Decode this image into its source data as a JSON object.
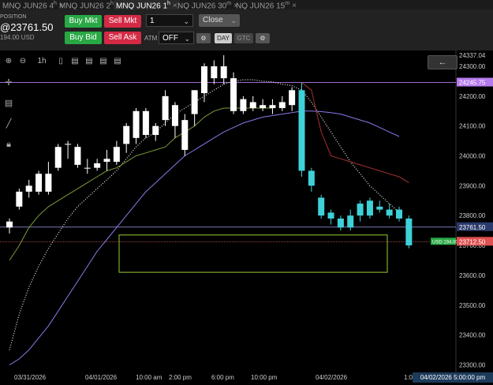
{
  "tabs": [
    {
      "label": "MNQ JUN26 4",
      "sup": "h",
      "active": false
    },
    {
      "label": "MNQ JUN26 2",
      "sup": "h",
      "active": false
    },
    {
      "label": "MNQ JUN26 1",
      "sup": "h",
      "active": true
    },
    {
      "label": "NQ JUN26 30",
      "sup": "m",
      "active": false
    },
    {
      "label": "NQ JUN26 15",
      "sup": "m",
      "active": false
    }
  ],
  "position": {
    "label": "POSITION",
    "price": "@23761.50",
    "sub": "194.00 USD"
  },
  "order": {
    "buy_mkt": "Buy Mkt",
    "sell_mkt": "Sell Mkt",
    "buy_bid": "Buy Bid",
    "sell_ask": "Sell Ask",
    "qty": "1",
    "close": "Close",
    "atm_label": "ATM",
    "atm_value": "OFF",
    "day": "DAY",
    "gtc": "GTC"
  },
  "toolbar": {
    "interval": "1h"
  },
  "price_axis": {
    "ticks": [
      "24337.04",
      "24300.00",
      "24200.00",
      "24100.00",
      "24000.00",
      "23900.00",
      "23800.00",
      "23700.00",
      "23600.00",
      "23500.00",
      "23400.00",
      "23300.00"
    ],
    "tick_values": [
      24337.04,
      24300,
      24200,
      24100,
      24000,
      23900,
      23800,
      23700,
      23600,
      23500,
      23400,
      23300
    ],
    "hline_upper_label": "24245.75",
    "hline_upper_value": 24245.75,
    "position_line_label": "23761.50",
    "position_line_value": 23761.5,
    "position_pnl": "USD 194.00",
    "last_price_label": "23712.50",
    "last_price_value": 23712.5,
    "colors": {
      "upper": "#b57bee",
      "position": "#2a3a6a",
      "pnl": "#29a845",
      "last": "#e05050"
    }
  },
  "time_axis": {
    "labels": [
      "03/31/2026",
      "04/01/2026",
      "10:00 am",
      "2:00 pm",
      "6:00 pm",
      "10:00 pm",
      "04/02/2026",
      "1:0"
    ],
    "crosshair_date": "04/02/2026 5:00:00 pm"
  },
  "chart_data": {
    "type": "candlestick",
    "ylim": [
      23280,
      24345
    ],
    "candles": [
      {
        "o": 23760,
        "h": 23790,
        "l": 23740,
        "c": 23780
      },
      {
        "o": 23830,
        "h": 23890,
        "l": 23820,
        "c": 23880
      },
      {
        "o": 23880,
        "h": 23920,
        "l": 23860,
        "c": 23900
      },
      {
        "o": 23880,
        "h": 23950,
        "l": 23870,
        "c": 23940
      },
      {
        "o": 23940,
        "h": 23980,
        "l": 23870,
        "c": 23880
      },
      {
        "o": 23960,
        "h": 24040,
        "l": 23950,
        "c": 24030
      },
      {
        "o": 24040,
        "h": 24050,
        "l": 23990,
        "c": 24040
      },
      {
        "o": 24030,
        "h": 24040,
        "l": 23960,
        "c": 23970
      },
      {
        "o": 23960,
        "h": 23990,
        "l": 23940,
        "c": 23960
      },
      {
        "o": 23960,
        "h": 23990,
        "l": 23950,
        "c": 23975
      },
      {
        "o": 23980,
        "h": 24020,
        "l": 23950,
        "c": 23990
      },
      {
        "o": 23980,
        "h": 24050,
        "l": 23970,
        "c": 24030
      },
      {
        "o": 24040,
        "h": 24110,
        "l": 24010,
        "c": 24100
      },
      {
        "o": 24060,
        "h": 24160,
        "l": 24040,
        "c": 24150
      },
      {
        "o": 24150,
        "h": 24160,
        "l": 24060,
        "c": 24070
      },
      {
        "o": 24070,
        "h": 24110,
        "l": 24050,
        "c": 24100
      },
      {
        "o": 24120,
        "h": 24220,
        "l": 24100,
        "c": 24200
      },
      {
        "o": 24100,
        "h": 24180,
        "l": 24060,
        "c": 24170
      },
      {
        "o": 24120,
        "h": 24140,
        "l": 24000,
        "c": 24020
      },
      {
        "o": 24140,
        "h": 24220,
        "l": 24100,
        "c": 24220
      },
      {
        "o": 24210,
        "h": 24310,
        "l": 24180,
        "c": 24300
      },
      {
        "o": 24260,
        "h": 24320,
        "l": 24240,
        "c": 24300
      },
      {
        "o": 24300,
        "h": 24337,
        "l": 24240,
        "c": 24260
      },
      {
        "o": 24260,
        "h": 24280,
        "l": 24140,
        "c": 24150
      },
      {
        "o": 24150,
        "h": 24200,
        "l": 24140,
        "c": 24190
      },
      {
        "o": 24180,
        "h": 24200,
        "l": 24150,
        "c": 24160
      },
      {
        "o": 24160,
        "h": 24190,
        "l": 24150,
        "c": 24170
      },
      {
        "o": 24170,
        "h": 24190,
        "l": 24140,
        "c": 24160
      },
      {
        "o": 24160,
        "h": 24200,
        "l": 24150,
        "c": 24180
      },
      {
        "o": 24170,
        "h": 24230,
        "l": 24150,
        "c": 24220
      },
      {
        "o": 24220,
        "h": 24246,
        "l": 23930,
        "c": 23950
      },
      {
        "o": 23950,
        "h": 23960,
        "l": 23880,
        "c": 23900
      },
      {
        "o": 23860,
        "h": 23870,
        "l": 23790,
        "c": 23800
      },
      {
        "o": 23810,
        "h": 23820,
        "l": 23770,
        "c": 23790
      },
      {
        "o": 23790,
        "h": 23800,
        "l": 23750,
        "c": 23760
      },
      {
        "o": 23760,
        "h": 23820,
        "l": 23750,
        "c": 23800
      },
      {
        "o": 23800,
        "h": 23850,
        "l": 23780,
        "c": 23840
      },
      {
        "o": 23800,
        "h": 23860,
        "l": 23790,
        "c": 23850
      },
      {
        "o": 23830,
        "h": 23850,
        "l": 23810,
        "c": 23820
      },
      {
        "o": 23820,
        "h": 23840,
        "l": 23790,
        "c": 23800
      },
      {
        "o": 23820,
        "h": 23830,
        "l": 23780,
        "c": 23790
      },
      {
        "o": 23790,
        "h": 23800,
        "l": 23690,
        "c": 23700
      }
    ],
    "series": [
      {
        "name": "",
        "style": "dotted",
        "color": "#e8e8e8",
        "values": [
          23350,
          23470,
          23560,
          23630,
          23690,
          23740,
          23790,
          23830,
          23860,
          23890,
          23920,
          23950,
          23990,
          24030,
          24060,
          24080,
          24110,
          24140,
          24160,
          24180,
          24200,
          24220,
          24240,
          24250,
          24255,
          24255,
          24250,
          24248,
          24240,
          24235,
          24220,
          24180,
          24130,
          24080,
          24030,
          23980,
          23940,
          23900,
          23870,
          23840,
          23810
        ]
      },
      {
        "name": "",
        "style": "solid",
        "color": "#7a9a3a",
        "values": [
          23650,
          23700,
          23760,
          23800,
          23830,
          23850,
          23870,
          23890,
          23910,
          23930,
          23950,
          23960,
          23980,
          24000,
          24010,
          24020,
          24030,
          24060,
          24080,
          24100,
          24130,
          24150,
          24160,
          24160,
          24160,
          24160,
          24160,
          24160
        ]
      },
      {
        "name": "",
        "style": "solid",
        "color": "#8a78e8",
        "values": [
          23300,
          23320,
          23350,
          23390,
          23430,
          23480,
          23530,
          23580,
          23630,
          23680,
          23720,
          23760,
          23800,
          23840,
          23880,
          23910,
          23940,
          23970,
          24000,
          24020,
          24040,
          24060,
          24080,
          24095,
          24110,
          24120,
          24130,
          24135,
          24140,
          24145,
          24150,
          24150,
          24148,
          24145,
          24140,
          24130,
          24120,
          24110,
          24095,
          24080,
          24065
        ]
      },
      {
        "name": "",
        "style": "solid",
        "color": "#a83030",
        "values": [
          24246,
          24220,
          24080,
          24000,
          23990,
          23980,
          23970,
          23960,
          23950,
          23940,
          23930,
          23910
        ]
      }
    ]
  }
}
